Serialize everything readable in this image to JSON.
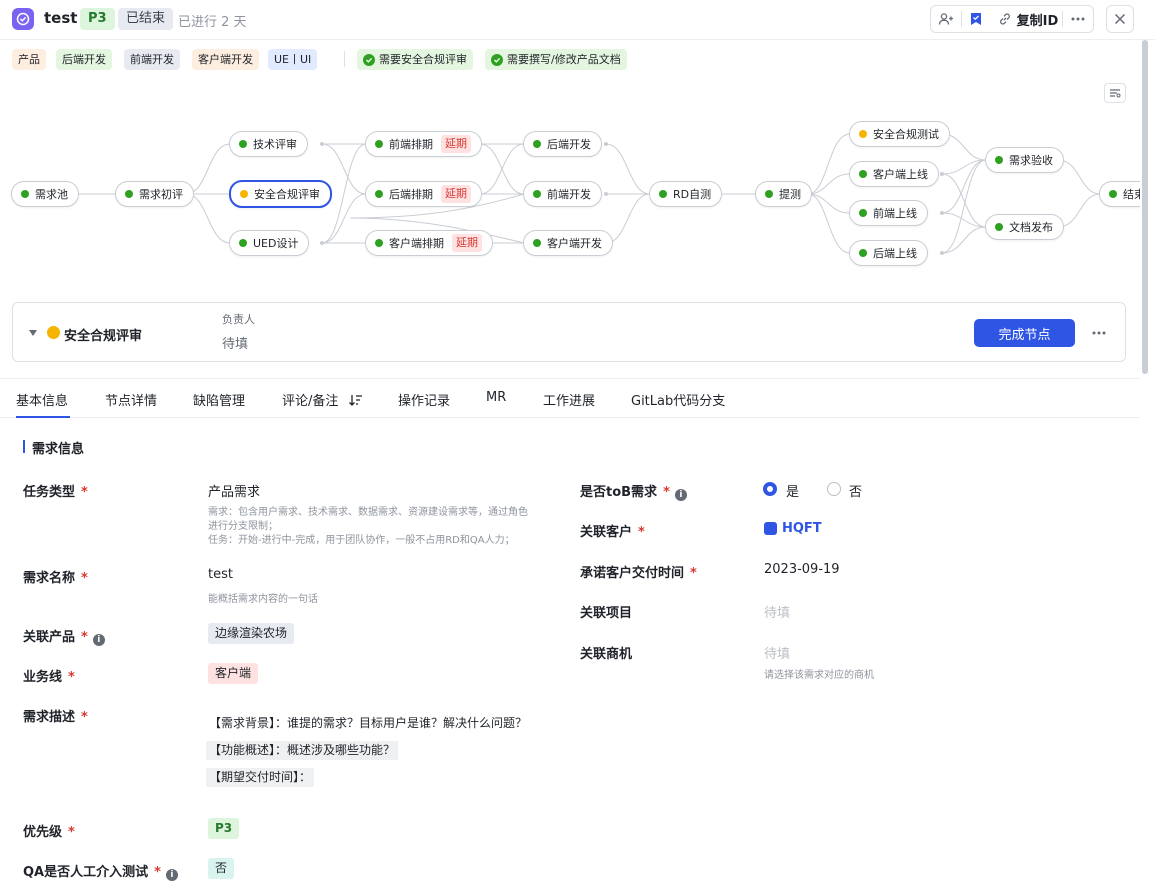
{
  "header": {
    "title": "test",
    "priority": "P3",
    "status": "已结束",
    "elapsed": "已进行 2 天",
    "copy_id_label": "复制ID"
  },
  "tags": [
    "产品",
    "后端开发",
    "前端开发",
    "客户端开发",
    "UE丨UI"
  ],
  "check_tags": [
    "需要安全合规评审",
    "需要撰写/修改产品文档"
  ],
  "flow": {
    "nodes": {
      "pool": "需求池",
      "initial": "需求初评",
      "tech_review": "技术评审",
      "security_review": "安全合规评审",
      "ued": "UED设计",
      "fe_schedule": "前端排期",
      "be_schedule": "后端排期",
      "client_schedule": "客户端排期",
      "be_dev": "后端开发",
      "fe_dev": "前端开发",
      "client_dev": "客户端开发",
      "rd_selftest": "RD自测",
      "submit_test": "提测",
      "security_test": "安全合规测试",
      "client_online": "客户端上线",
      "fe_online": "前端上线",
      "be_online": "后端上线",
      "acceptance": "需求验收",
      "doc_release": "文档发布",
      "end": "结束"
    },
    "delay_label": "延期"
  },
  "current_node": {
    "name": "安全合规评审",
    "owner_label": "负责人",
    "owner_value": "待填",
    "complete_button": "完成节点"
  },
  "tabs": [
    "基本信息",
    "节点详情",
    "缺陷管理",
    "评论/备注",
    "操作记录",
    "MR",
    "工作进展",
    "GitLab代码分支"
  ],
  "section_title": "需求信息",
  "left_fields": {
    "task_type": {
      "label": "任务类型",
      "value": "产品需求",
      "hint1": "需求：包含用户需求、技术需求、数据需求、资源建设需求等，通过角色",
      "hint2": "进行分支限制；",
      "hint3": "任务：开始-进行中-完成，用于团队协作，一般不占用RD和QA人力；"
    },
    "req_name": {
      "label": "需求名称",
      "value": "test",
      "hint": "能概括需求内容的一句话"
    },
    "product": {
      "label": "关联产品",
      "value": "边缘渲染农场"
    },
    "business": {
      "label": "业务线",
      "value": "客户端"
    },
    "description": {
      "label": "需求描述",
      "line1": "【需求背景】：谁提的需求？目标用户是谁？解决什么问题？",
      "line2": "【功能概述】：概述涉及哪些功能？",
      "line3": "【期望交付时间】："
    },
    "priority": {
      "label": "优先级",
      "value": "P3"
    },
    "qa_manual": {
      "label": "QA是否人工介入测试",
      "value": "否"
    }
  },
  "right_fields": {
    "tob": {
      "label": "是否toB需求",
      "yes": "是",
      "no": "否"
    },
    "customer": {
      "label": "关联客户",
      "value": "HQFT"
    },
    "delivery": {
      "label": "承诺客户交付时间",
      "value": "2023-09-19"
    },
    "project": {
      "label": "关联项目",
      "placeholder": "待填"
    },
    "opportunity": {
      "label": "关联商机",
      "placeholder": "待填",
      "hint": "请选择该需求对应的商机"
    }
  },
  "colors": {
    "accent": "#2e55e3",
    "green": "#2ea121",
    "yellow": "#f5b400",
    "danger": "#d83931"
  }
}
